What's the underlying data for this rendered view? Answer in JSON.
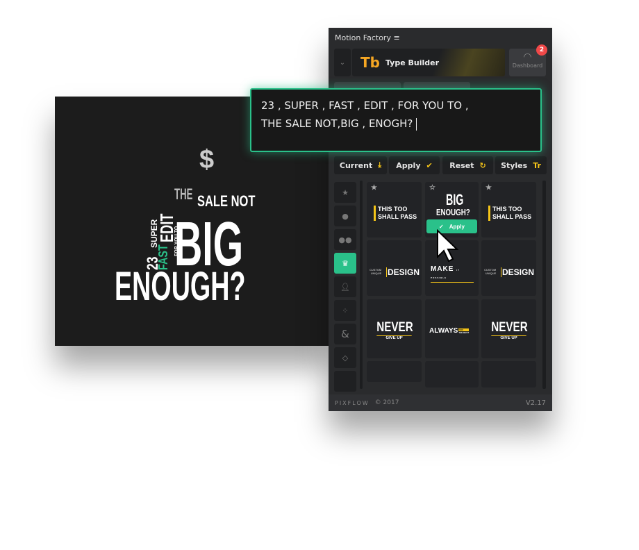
{
  "colors": {
    "accent": "#2ac18a",
    "yellow": "#f5c518",
    "badge": "#f04848"
  },
  "preview": {
    "dollar": "$",
    "the": "THE",
    "sale_not": "SALE NOT",
    "n23": "23",
    "super": "SUPER",
    "fast": "FAST",
    "edit": "EDIT",
    "for_you_to": "FOR YOU TO",
    "big": "BIG",
    "enough": "ENOUGH?"
  },
  "panel": {
    "title": "Motion Factory",
    "menu_icon": "hamburger-icon",
    "logo": "Tb",
    "module": "Type Builder",
    "dashboard": "Dashboard",
    "badge": "2"
  },
  "popup": {
    "line1": "23 , SUPER , FAST , EDIT , FOR YOU TO ,",
    "line2": "THE SALE NOT,BIG , ENOGH?"
  },
  "buttons": {
    "current": "Current",
    "apply": "Apply",
    "reset": "Reset",
    "styles": "Styles"
  },
  "sidebar": [
    "star-icon",
    "dot-icon",
    "two-dots-icon",
    "crown-icon",
    "person-icon",
    "people-icon",
    "ampersand-icon",
    "diamond-icon",
    ""
  ],
  "cards": {
    "this_too": "THIS TOO",
    "shall_pass": "SHALL PASS",
    "custom": "CUSTOM",
    "unique": "UNIQUE",
    "design": "DESIGN",
    "make": "MAKE",
    "possible": "IT POSSIBLE",
    "never": "NEVER",
    "give_up": "GIVE UP",
    "always": "ALWAYS",
    "for": "FOR",
    "the_best": "THE BEST",
    "mini_big": "BIG",
    "mini_enough": "ENOUGH?",
    "apply": "Apply"
  },
  "footer": {
    "brand": "PIXFLOW",
    "copyright": "© 2017",
    "version": "V2.17"
  }
}
